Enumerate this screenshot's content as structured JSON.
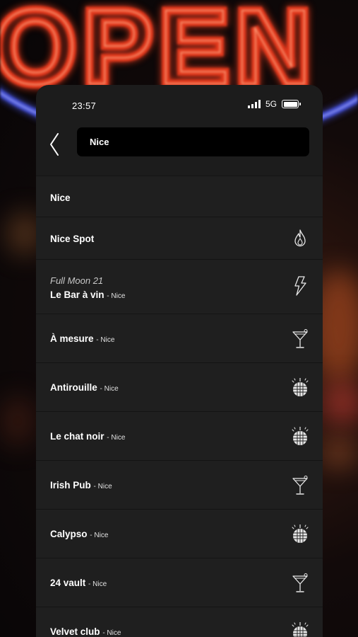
{
  "status": {
    "time": "23:57",
    "network": "5G"
  },
  "search": {
    "value": "Nice"
  },
  "results": [
    {
      "title": "Nice",
      "city": "",
      "event": "",
      "icon": ""
    },
    {
      "title": "Nice Spot",
      "city": "",
      "event": "",
      "icon": "flame-icon"
    },
    {
      "title": "Le Bar à vin",
      "city": "- Nice",
      "event": "Full Moon 21",
      "icon": "lightning-icon"
    },
    {
      "title": "À mesure",
      "city": "- Nice",
      "event": "",
      "icon": "cocktail-icon"
    },
    {
      "title": "Antirouille",
      "city": "- Nice",
      "event": "",
      "icon": "disco-ball-icon"
    },
    {
      "title": "Le chat noir",
      "city": "- Nice",
      "event": "",
      "icon": "disco-ball-icon"
    },
    {
      "title": "Irish Pub",
      "city": "- Nice",
      "event": "",
      "icon": "cocktail-icon"
    },
    {
      "title": "Calypso",
      "city": "- Nice",
      "event": "",
      "icon": "disco-ball-icon"
    },
    {
      "title": "24 vault",
      "city": "- Nice",
      "event": "",
      "icon": "cocktail-icon"
    },
    {
      "title": "Velvet club",
      "city": "- Nice",
      "event": "",
      "icon": "disco-ball-icon"
    }
  ],
  "background": {
    "sign_text": "OPEN"
  },
  "colors": {
    "panel": "#1c1c1c",
    "row": "#1f1f1f",
    "input": "#000000",
    "neon_red": "#e2371c",
    "neon_blue": "#4a57e8"
  }
}
